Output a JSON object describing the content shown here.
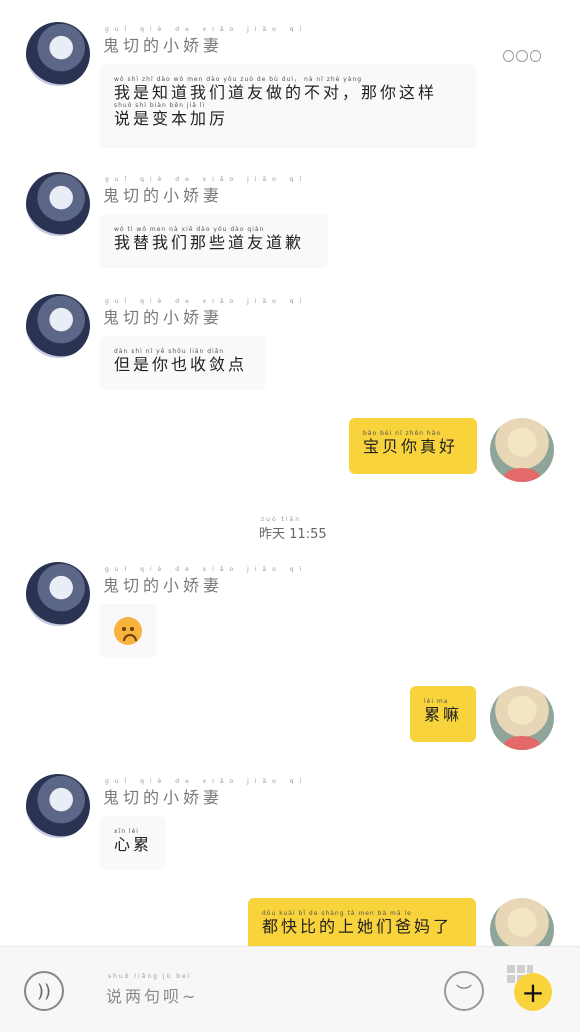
{
  "sender_name": "鬼切的小娇妻",
  "sender_pinyin": "guǐ qiè de xiǎo jiāo qī",
  "messages": [
    {
      "side": "left",
      "pinyin": "wǒ shì zhī dào wǒ men dào yǒu zuò de bù duì， nà nǐ zhè yàng",
      "text_line1": "我是知道我们道友做的不对，那你这样",
      "pinyin2": "shuō shì biàn běn jiā lì",
      "text_line2": "说是变本加厉"
    },
    {
      "side": "left",
      "pinyin": "wǒ tì wǒ men nà xiē dào yǒu dào qiàn",
      "text": "我替我们那些道友道歉"
    },
    {
      "side": "left",
      "pinyin": "dàn shì nǐ yě shōu liǎn diǎn",
      "text": "但是你也收敛点"
    },
    {
      "side": "right",
      "pinyin": "bǎo bèi nǐ zhēn hǎo",
      "text": "宝贝你真好"
    },
    {
      "side": "left",
      "type": "emoji",
      "emoji": "worried-face"
    },
    {
      "side": "right",
      "pinyin": "lèi ma",
      "text": "累嘛"
    },
    {
      "side": "left",
      "pinyin": "xīn lèi",
      "text": "心累"
    },
    {
      "side": "right",
      "pinyin": "dōu kuài bǐ de shàng tā men bà mā le",
      "text": "都快比的上她们爸妈了"
    }
  ],
  "timestamp": {
    "pinyin": "zuó tiān",
    "date": "昨天",
    "time": "11:55"
  },
  "input": {
    "pinyin": "shuō liǎng jù bei",
    "placeholder": "说两句呗~"
  },
  "icons": {
    "more": "more-icon",
    "voice": "voice-icon",
    "emoji": "emoji-icon",
    "plus": "plus-icon"
  },
  "colors": {
    "accent": "#f8d33b",
    "bubble_left": "#fbf8fc"
  }
}
